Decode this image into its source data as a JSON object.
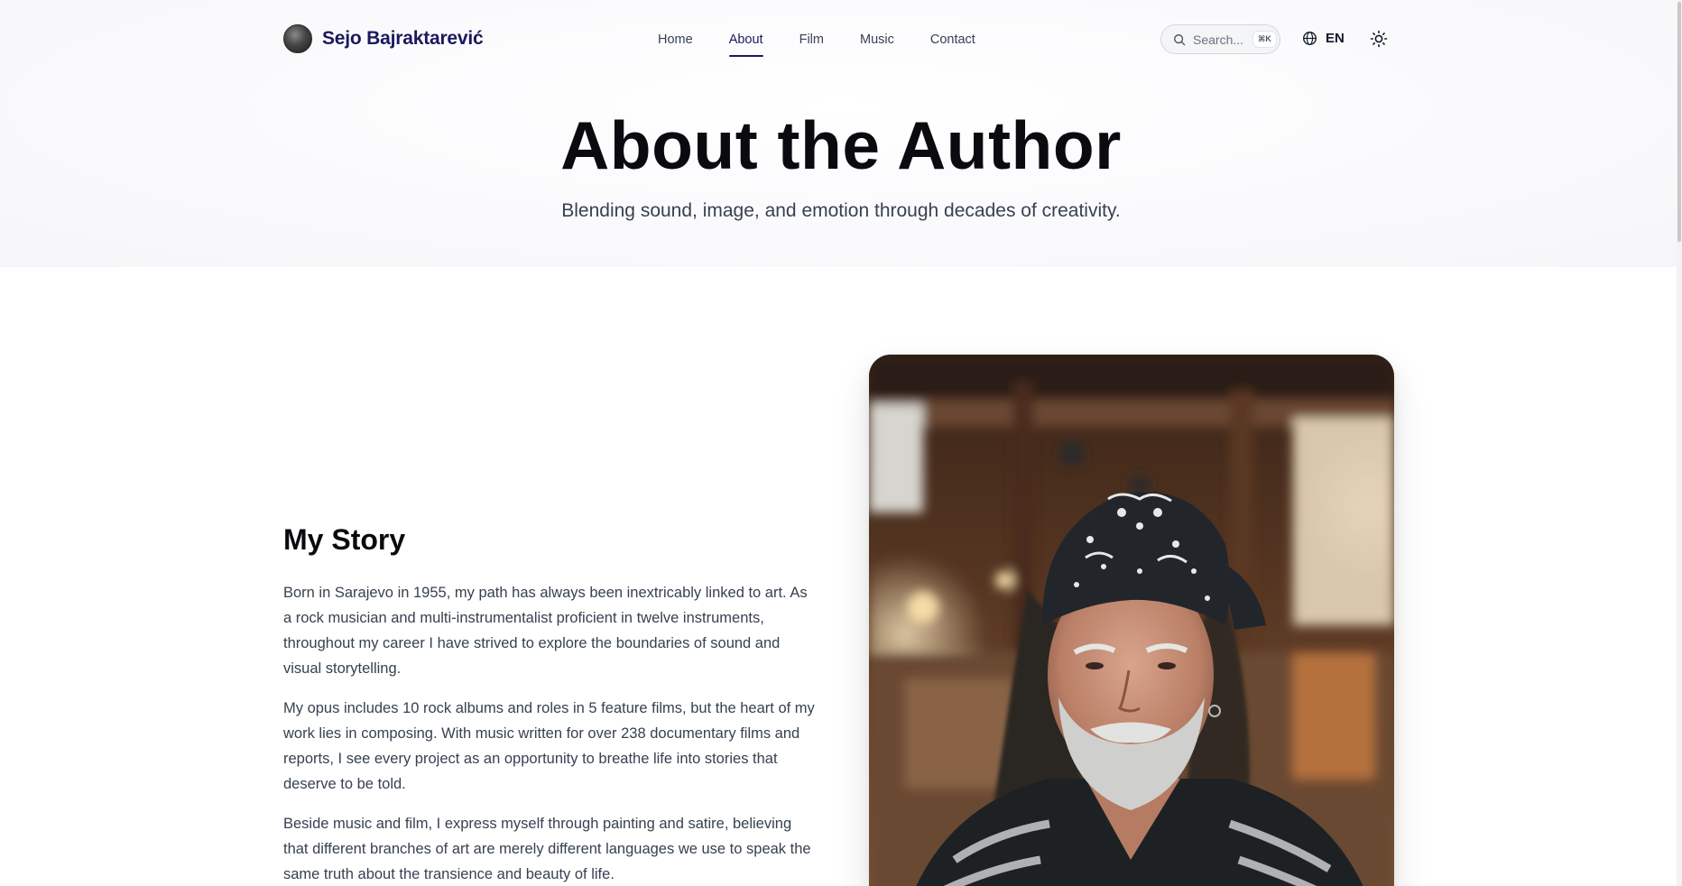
{
  "brand": {
    "name": "Sejo Bajraktarević"
  },
  "nav": {
    "items": [
      {
        "label": "Home",
        "active": false
      },
      {
        "label": "About",
        "active": true
      },
      {
        "label": "Film",
        "active": false
      },
      {
        "label": "Music",
        "active": false
      },
      {
        "label": "Contact",
        "active": false
      }
    ]
  },
  "search": {
    "placeholder": "Search...",
    "shortcut": "⌘K"
  },
  "language": {
    "code": "EN"
  },
  "hero": {
    "title": "About the Author",
    "subtitle": "Blending sound, image, and emotion through decades of creativity."
  },
  "story": {
    "title": "My Story",
    "paragraphs": [
      "Born in Sarajevo in 1955, my path has always been inextricably linked to art. As a rock musician and multi-instrumentalist proficient in twelve instruments, throughout my career I have strived to explore the boundaries of sound and visual storytelling.",
      "My opus includes 10 rock albums and roles in 5 feature films, but the heart of my work lies in composing. With music written for over 238 documentary films and reports, I see every project as an opportunity to breathe life into stories that deserve to be told.",
      "Beside music and film, I express myself through painting and satire, believing that different branches of art are merely different languages we use to speak the same truth about the transience and beauty of life."
    ]
  },
  "colors": {
    "brand": "#1a1a5e",
    "heading": "#0b0b0f",
    "body_text": "#374151"
  },
  "icons": {
    "search": "search-icon",
    "language": "globe-icon",
    "theme": "sun-icon"
  }
}
